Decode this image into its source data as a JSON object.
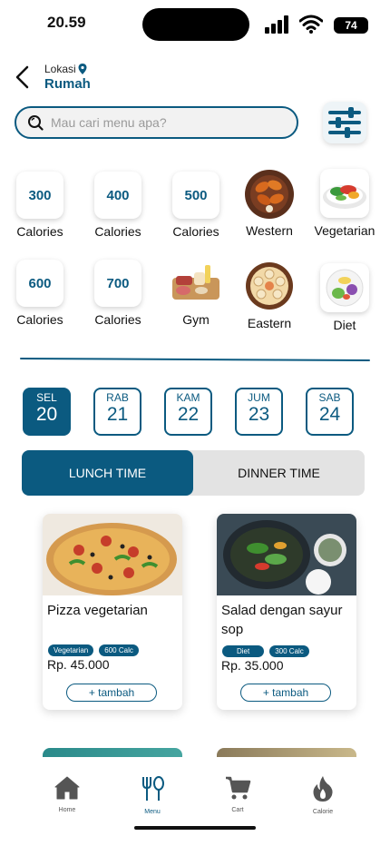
{
  "status": {
    "time": "20.59",
    "battery": "74"
  },
  "header": {
    "location_label": "Lokasi",
    "location_value": "Rumah"
  },
  "search": {
    "placeholder": "Mau cari menu apa?"
  },
  "categories": [
    {
      "value": "300",
      "label": "Calories"
    },
    {
      "value": "400",
      "label": "Calories"
    },
    {
      "value": "500",
      "label": "Calories"
    },
    {
      "label": "Western",
      "icon": "western-food-icon"
    },
    {
      "label": "Vegetarian",
      "icon": "vegetarian-food-icon"
    },
    {
      "value": "600",
      "label": "Calories"
    },
    {
      "value": "700",
      "label": "Calories"
    },
    {
      "label": "Gym",
      "icon": "gym-food-icon"
    },
    {
      "label": "Eastern",
      "icon": "eastern-food-icon"
    },
    {
      "label": "Diet",
      "icon": "diet-food-icon"
    }
  ],
  "dates": [
    {
      "day": "SEL",
      "num": "20",
      "active": true
    },
    {
      "day": "RAB",
      "num": "21",
      "active": false
    },
    {
      "day": "KAM",
      "num": "22",
      "active": false
    },
    {
      "day": "JUM",
      "num": "23",
      "active": false
    },
    {
      "day": "SAB",
      "num": "24",
      "active": false
    }
  ],
  "tabs": {
    "lunch": "LUNCH TIME",
    "dinner": "DINNER TIME"
  },
  "foods": [
    {
      "title": "Pizza vegetarian",
      "tags": [
        "Vegetarian",
        "600 Calc"
      ],
      "price": "Rp. 45.000",
      "button": "+ tambah"
    },
    {
      "title": "Salad dengan sayur sop",
      "tags": [
        "Diet",
        "300 Calc"
      ],
      "price": "Rp. 35.000",
      "button": "+ tambah"
    }
  ],
  "nav": {
    "home": "Home",
    "menu": "Menu",
    "cart": "Cart",
    "calorie": "Calorie"
  },
  "colors": {
    "primary": "#0b5a80",
    "tab_inactive": "#e3e3e3"
  }
}
